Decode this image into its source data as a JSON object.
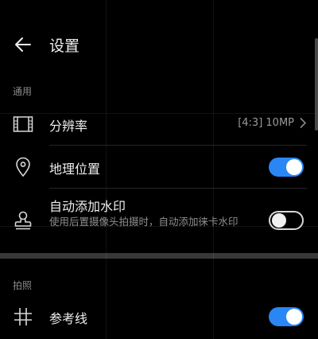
{
  "header": {
    "title": "设置",
    "back_icon": "arrow-left-icon"
  },
  "sections": {
    "general": {
      "label": "通用"
    },
    "photo": {
      "label": "拍照"
    }
  },
  "items": {
    "resolution": {
      "label": "分辨率",
      "value": "[4:3] 10MP",
      "icon": "resolution-frame-icon"
    },
    "location": {
      "label": "地理位置",
      "enabled": true,
      "icon": "location-pin-icon"
    },
    "watermark": {
      "label": "自动添加水印",
      "desc": "使用后置摄像头拍摄时，自动添加徕卡水印",
      "enabled": false,
      "icon": "stamp-icon"
    },
    "gridlines": {
      "label": "参考线",
      "enabled": true,
      "icon": "grid-icon"
    }
  },
  "colors": {
    "accent": "#2a86f5",
    "background": "#000000"
  }
}
